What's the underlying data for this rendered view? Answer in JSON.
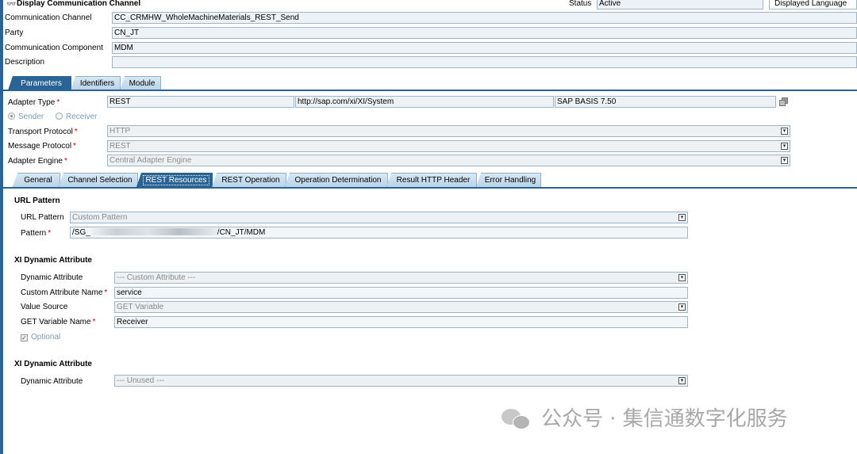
{
  "header": {
    "title": "Display Communication Channel",
    "status_label": "Status",
    "status_value": "Active",
    "displayed_language_label": "Displayed Language"
  },
  "object": {
    "channel_label": "Communication Channel",
    "channel_value": "CC_CRMHW_WholeMachineMaterials_REST_Send",
    "party_label": "Party",
    "party_value": "CN_JT",
    "component_label": "Communication Component",
    "component_value": "MDM",
    "description_label": "Description",
    "description_value": ""
  },
  "top_tabs": [
    "Parameters",
    "Identifiers",
    "Module"
  ],
  "adapter": {
    "type_label": "Adapter Type",
    "type_value": "REST",
    "namespace_value": "http://sap.com/xi/XI/System",
    "release_value": "SAP BASIS 7.50",
    "sender_label": "Sender",
    "receiver_label": "Receiver",
    "transport_label": "Transport Protocol",
    "transport_value": "HTTP",
    "message_label": "Message Protocol",
    "message_value": "REST",
    "engine_label": "Adapter Engine",
    "engine_value": "Central Adapter Engine"
  },
  "sub_tabs": [
    "General",
    "Channel Selection",
    "REST Resources",
    "REST Operation",
    "Operation Determination",
    "Result HTTP Header",
    "Error Handling"
  ],
  "url_pattern": {
    "section_title": "URL Pattern",
    "url_pattern_label": "URL Pattern",
    "url_pattern_value": "Custom Pattern",
    "pattern_label": "Pattern",
    "pattern_value_start": "/SG_",
    "pattern_value_end": "/CN_JT/MDM"
  },
  "dyn1": {
    "section_title": "XI Dynamic Attribute",
    "attr_label": "Dynamic Attribute",
    "attr_value": "--- Custom Attribute ---",
    "custom_name_label": "Custom Attribute Name",
    "custom_name_value": "service",
    "value_source_label": "Value Source",
    "value_source_value": "GET Variable",
    "get_var_label": "GET Variable Name",
    "get_var_value": "Receiver",
    "optional_label": "Optional"
  },
  "dyn2": {
    "section_title": "XI Dynamic Attribute",
    "attr_label": "Dynamic Attribute",
    "attr_value": "--- Unused ---"
  },
  "watermark": {
    "text": "公众号 · 集信通数字化服务"
  }
}
